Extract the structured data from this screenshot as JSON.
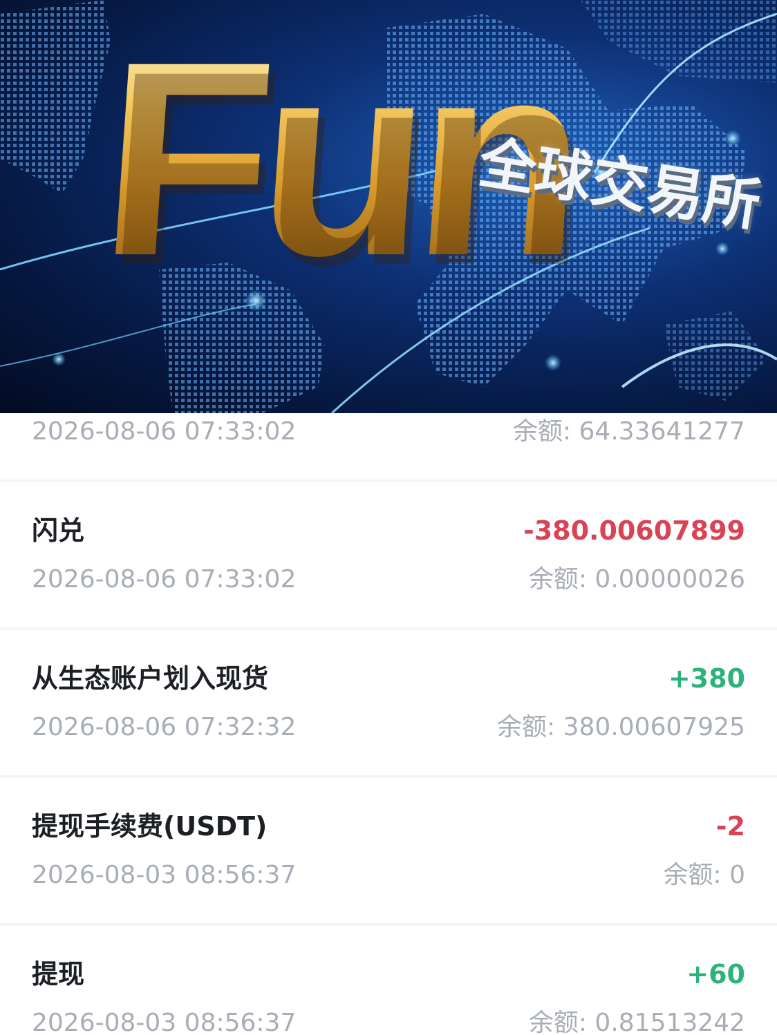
{
  "banner": {
    "brand_word": "Fun",
    "brand_sub": "全球交易所",
    "colors": {
      "gold": "#e8b24a",
      "deep_blue": "#061a45",
      "glow_blue": "#4fc3ff"
    }
  },
  "records": [
    {
      "title": "",
      "amount": "",
      "amount_type": "",
      "time": "2026-08-06 07:33:02",
      "balance": "余额: 64.33641277"
    },
    {
      "title": "闪兑",
      "amount": "-380.00607899",
      "amount_type": "negative",
      "time": "2026-08-06 07:33:02",
      "balance": "余额: 0.00000026"
    },
    {
      "title": "从生态账户划入现货",
      "amount": "+380",
      "amount_type": "positive",
      "time": "2026-08-06 07:32:32",
      "balance": "余额: 380.00607925"
    },
    {
      "title": "提现手续费(USDT)",
      "amount": "-2",
      "amount_type": "negative",
      "time": "2026-08-03 08:56:37",
      "balance": "余额: 0"
    },
    {
      "title": "提现",
      "amount": "+60",
      "amount_type": "positive",
      "time": "2026-08-03 08:56:37",
      "balance": "余额: 0.81513242"
    }
  ],
  "colors": {
    "negative": "#d84455",
    "positive": "#2db37a",
    "secondary_text": "#a8adb6",
    "primary_text": "#1c1f24"
  }
}
